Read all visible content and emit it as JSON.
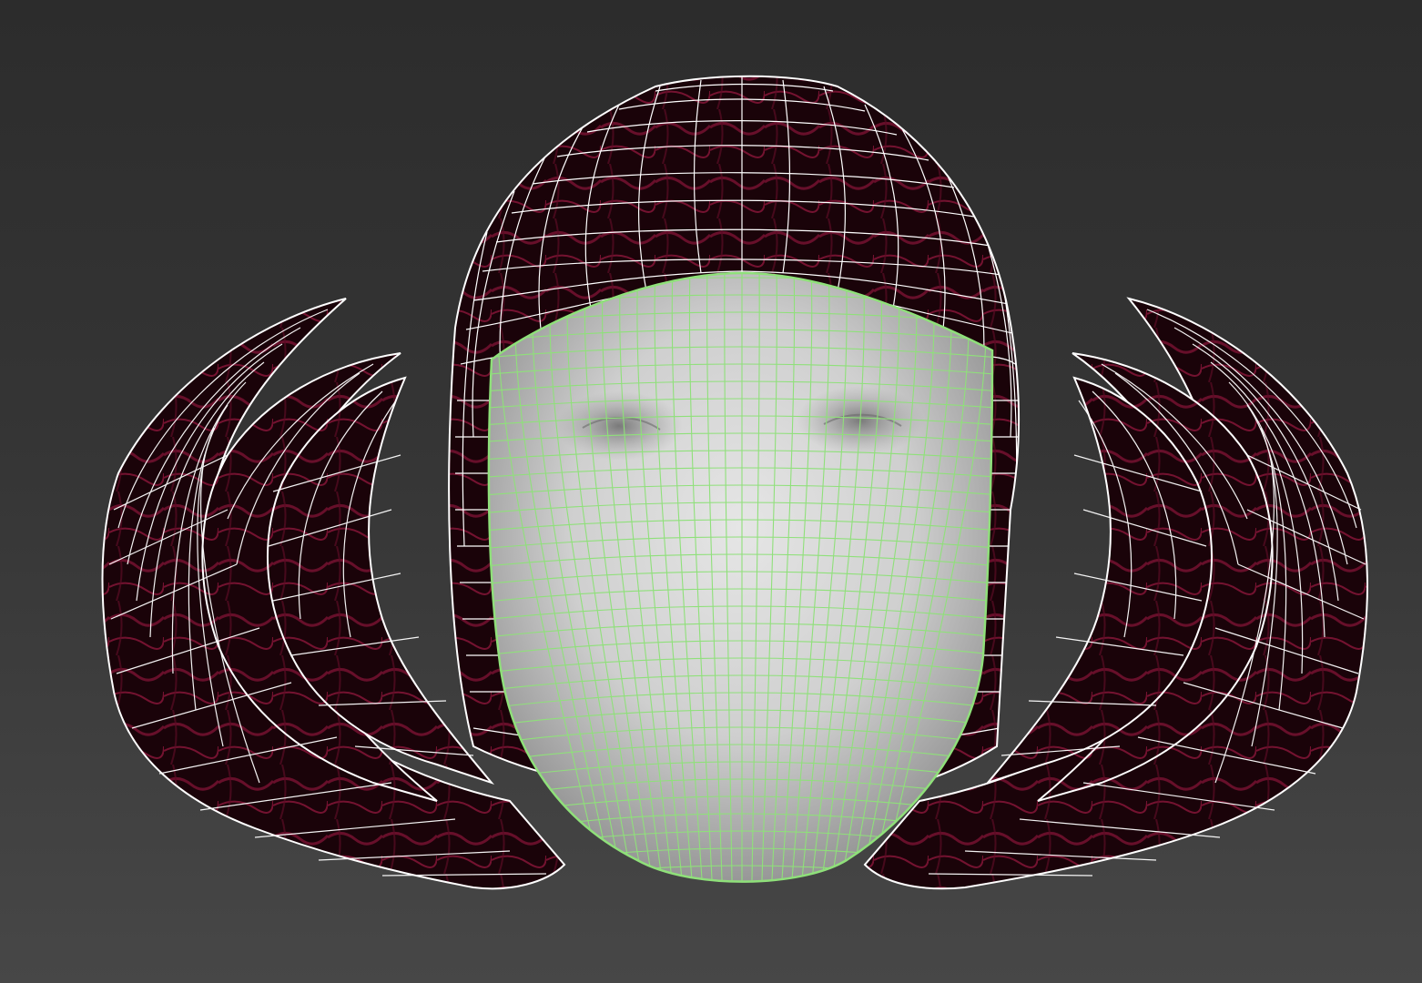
{
  "viewport": {
    "name": "3D viewport",
    "background_top": "#2c2c2c",
    "background_bottom": "#474747"
  },
  "objects": {
    "hair": {
      "wire_color": "#ffffff",
      "fill_color": "#1a0309",
      "streak_color": "#b01c4a",
      "selected": false
    },
    "face": {
      "wire_color": "#8fe07a",
      "shade_light": "#e4e4e4",
      "shade_dark": "#8c8c8c",
      "selected": true
    }
  }
}
